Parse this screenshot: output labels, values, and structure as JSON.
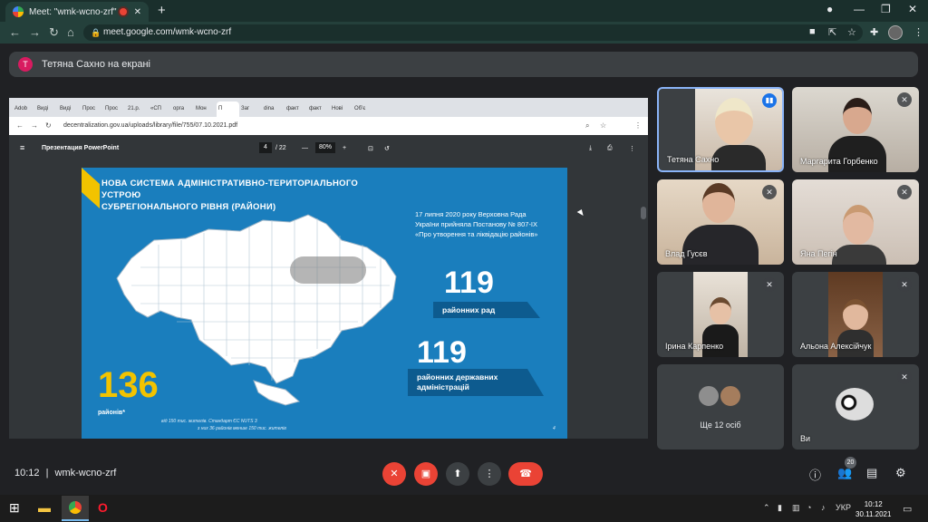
{
  "browser": {
    "tab_title": "Meet: \"wmk-wcno-zrf\"",
    "tab_close": "✕",
    "new_tab": "+",
    "url": "meet.google.com/wmk-wcno-zrf",
    "window_controls": [
      "—",
      "❐",
      "✕"
    ]
  },
  "banner": {
    "avatar_letter": "Т",
    "text": "Тетяна Сахно на екрані"
  },
  "shared_screen": {
    "inner_tabs": [
      "Adob",
      "Виді",
      "Виді",
      "Прос",
      "Прос",
      "21.р.",
      "«СП",
      "орга",
      "Мон",
      "П",
      "Заг",
      "dina",
      "факт",
      "факт",
      "Нові",
      "Об'є"
    ],
    "active_tab_index": 9,
    "url": "decentralization.gov.ua/uploads/library/file/755/07.10.2021.pdf",
    "pdf_title": "Презентация PowerPoint",
    "page_current": "4",
    "page_total": "/ 22",
    "zoom": "80%",
    "slide": {
      "title_line1": "НОВА СИСТЕМА АДМІНІСТРАТИВНО-ТЕРИТОРІАЛЬНОГО УСТРОЮ",
      "title_line2": "СУБРЕГІОНАЛЬНОГО РІВНЯ (РАЙОНИ)",
      "intro": "17 липня 2020 року Верховна Рада України прийняла Постанову № 807-ІХ «Про утворення та ліквідацію районів»",
      "stat1_value": "119",
      "stat1_label": "районних рад",
      "stat2_value": "119",
      "stat2_label": "районних державних адміністрацій",
      "districts_value": "136",
      "districts_label": "районів*",
      "footnote1": "від 150 тис. жителів. Стандарт ЄС NUTS 3",
      "footnote2": "з них 36 районів менше 150 тис. жителів",
      "page_num": "4"
    }
  },
  "participants": [
    {
      "name": "Тетяна Сахно",
      "speaking": true
    },
    {
      "name": "Маргарита Горбенко",
      "muted": true
    },
    {
      "name": "Влад Гусєв",
      "muted": true
    },
    {
      "name": "Яна Пегін",
      "muted": true
    },
    {
      "name": "Ірина Карпенко",
      "muted": true
    },
    {
      "name": "Альона Алексійчук",
      "muted": true
    },
    {
      "name": "Ще 12 осіб"
    },
    {
      "name": "Ви",
      "muted": true
    }
  ],
  "bottom": {
    "time": "10:12",
    "separator": "|",
    "meeting_code": "wmk-wcno-zrf",
    "participant_count": "20"
  },
  "taskbar": {
    "language": "УКР",
    "time": "10:12",
    "date": "30.11.2021"
  },
  "colors": {
    "slide_blue": "#1a7ebd",
    "accent_yellow": "#f2c300",
    "meet_red": "#ea4335",
    "speaking_blue": "#1a73e8"
  }
}
